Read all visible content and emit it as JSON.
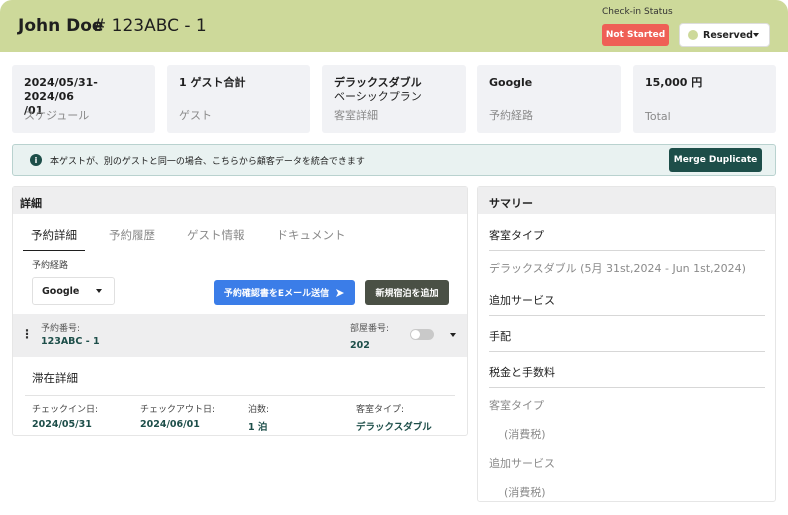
{
  "header": {
    "guest_name": "John Doe",
    "booking_number": "# 123ABC - 1",
    "checkin_label": "Check-in Status",
    "checkin_status": "Not Started",
    "reservation_status": "Reserved"
  },
  "cards": [
    {
      "value": "2024/05/31-2024/06",
      "value2": "/01",
      "label": "スケジュール"
    },
    {
      "value": "1 ゲスト合計",
      "value2": "",
      "label": "ゲスト"
    },
    {
      "value": "デラックスダブル",
      "value2": "ベーシックプラン",
      "label": "客室詳細"
    },
    {
      "value": "Google",
      "value2": "",
      "label": "予約経路"
    },
    {
      "value": "15,000 円",
      "value2": "",
      "label": "Total"
    }
  ],
  "info": {
    "icon": "info-icon",
    "text": "本ゲストが、別のゲストと同一の場合、こちらから顧客データを統合できます",
    "button": "Merge Duplicate"
  },
  "details": {
    "title": "詳細",
    "tabs": [
      "予約詳細",
      "予約履歴",
      "ゲスト情報",
      "ドキュメント"
    ],
    "route_label": "予約経路",
    "route_value": "Google",
    "email_button": "予約確認書をEメール送信",
    "add_button": "新規宿泊を追加",
    "booking": {
      "number_label": "予約番号:",
      "number_value": "123ABC - 1",
      "room_label": "部屋番号:",
      "room_value": "202"
    },
    "stay": {
      "title": "滞在詳細",
      "checkin_label": "チェックイン日:",
      "checkin_value": "2024/05/31",
      "checkout_label": "チェックアウト日:",
      "checkout_value": "2024/06/01",
      "nights_label": "泊数:",
      "nights_value": "1 泊",
      "room_type_label": "客室タイプ:",
      "room_type_value": "デラックスダブル"
    }
  },
  "summary": {
    "title": "サマリー",
    "rows": [
      {
        "text": "客室タイプ",
        "muted": false
      },
      {
        "text": "デラックスダブル (5月 31st,2024 - Jun 1st,2024)",
        "muted": true
      },
      {
        "text": "追加サービス",
        "muted": false
      },
      {
        "text": "手配",
        "muted": false
      },
      {
        "text": "税金と手数料",
        "muted": false
      },
      {
        "text": "客室タイプ",
        "muted": true
      },
      {
        "text": "(消費税)",
        "muted": true
      },
      {
        "text": "追加サービス",
        "muted": true
      },
      {
        "text": "(消費税)",
        "muted": true
      }
    ]
  }
}
